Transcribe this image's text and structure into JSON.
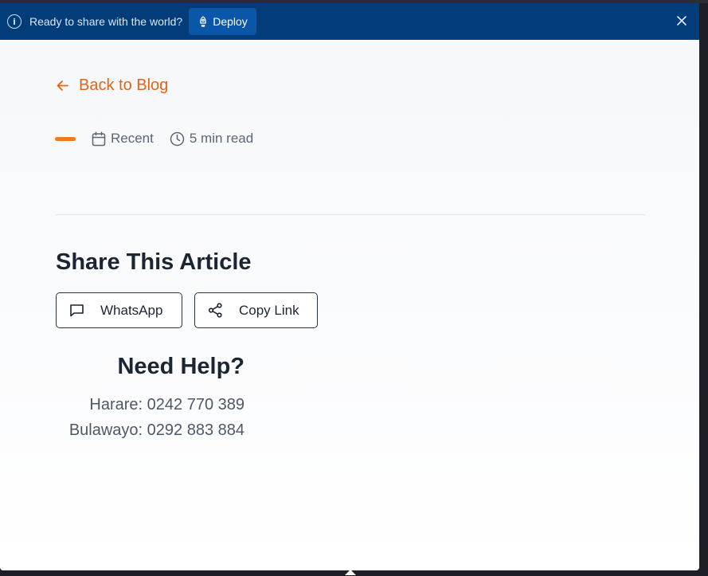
{
  "banner": {
    "message": "Ready to share with the world?",
    "deploy_label": "Deploy",
    "icons": {
      "info": "info-icon",
      "deploy": "rocket-icon",
      "close": "close-icon"
    }
  },
  "back_link": {
    "label": "Back to Blog",
    "icon": "arrow-left-icon"
  },
  "meta": {
    "date_label": "Recent",
    "read_time": "5 min read",
    "icons": {
      "date": "calendar-icon",
      "time": "clock-icon"
    }
  },
  "share": {
    "title": "Share This Article",
    "buttons": [
      {
        "label": "WhatsApp",
        "icon": "message-icon"
      },
      {
        "label": "Copy Link",
        "icon": "share-icon"
      }
    ]
  },
  "help": {
    "title": "Need Help?",
    "lines": [
      "Harare: 0242 770 389",
      "Bulawayo: 0292 883 884"
    ]
  },
  "colors": {
    "banner_bg": "#023d7a",
    "deploy_bg": "#0a56a8",
    "accent": "#e36414",
    "accent_bar": "#f27a1a",
    "text_dark": "#1c2533",
    "text_muted": "#5b6577"
  }
}
